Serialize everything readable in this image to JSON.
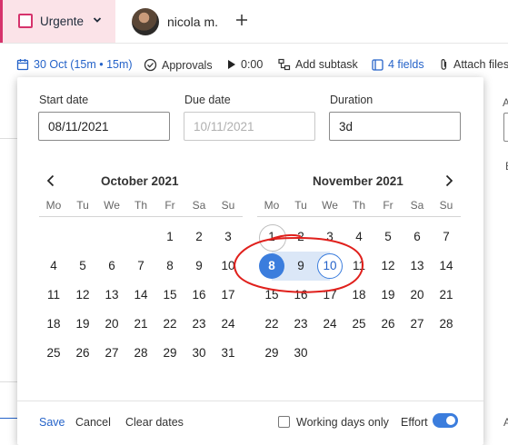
{
  "header": {
    "status_label": "Urgente",
    "user_name": "nicola m."
  },
  "toolbar": {
    "date_label": "30 Oct (15m • 15m)",
    "approvals_label": "Approvals",
    "time_label": "0:00",
    "add_subtask_label": "Add subtask",
    "fields_label": "4 fields",
    "attach_label": "Attach files"
  },
  "background": {
    "right_a": "A",
    "right_e": "E",
    "right_a2": "A"
  },
  "date_picker": {
    "start_date_label": "Start date",
    "start_date_value": "08/11/2021",
    "due_date_label": "Due date",
    "due_date_placeholder": "10/11/2021",
    "duration_label": "Duration",
    "duration_value": "3d",
    "weekdays": [
      "Mo",
      "Tu",
      "We",
      "Th",
      "Fr",
      "Sa",
      "Su"
    ],
    "months": [
      {
        "title": "October 2021",
        "days": [
          {
            "d": "",
            "empty": true
          },
          {
            "d": "",
            "empty": true
          },
          {
            "d": "",
            "empty": true
          },
          {
            "d": "",
            "empty": true
          },
          {
            "d": "1"
          },
          {
            "d": "2"
          },
          {
            "d": "3"
          },
          {
            "d": "4"
          },
          {
            "d": "5"
          },
          {
            "d": "6"
          },
          {
            "d": "7"
          },
          {
            "d": "8"
          },
          {
            "d": "9"
          },
          {
            "d": "10"
          },
          {
            "d": "11"
          },
          {
            "d": "12"
          },
          {
            "d": "13"
          },
          {
            "d": "14"
          },
          {
            "d": "15"
          },
          {
            "d": "16"
          },
          {
            "d": "17"
          },
          {
            "d": "18"
          },
          {
            "d": "19"
          },
          {
            "d": "20"
          },
          {
            "d": "21"
          },
          {
            "d": "22"
          },
          {
            "d": "23"
          },
          {
            "d": "24"
          },
          {
            "d": "25"
          },
          {
            "d": "26"
          },
          {
            "d": "27"
          },
          {
            "d": "28"
          },
          {
            "d": "29"
          },
          {
            "d": "30"
          },
          {
            "d": "31"
          }
        ]
      },
      {
        "title": "November 2021",
        "days": [
          {
            "d": "1",
            "state": "today"
          },
          {
            "d": "2"
          },
          {
            "d": "3"
          },
          {
            "d": "4"
          },
          {
            "d": "5"
          },
          {
            "d": "6"
          },
          {
            "d": "7"
          },
          {
            "d": "8",
            "state": "start"
          },
          {
            "d": "9",
            "state": "range"
          },
          {
            "d": "10",
            "state": "end"
          },
          {
            "d": "11"
          },
          {
            "d": "12"
          },
          {
            "d": "13"
          },
          {
            "d": "14"
          },
          {
            "d": "15"
          },
          {
            "d": "16"
          },
          {
            "d": "17"
          },
          {
            "d": "18"
          },
          {
            "d": "19"
          },
          {
            "d": "20"
          },
          {
            "d": "21"
          },
          {
            "d": "22"
          },
          {
            "d": "23"
          },
          {
            "d": "24"
          },
          {
            "d": "25"
          },
          {
            "d": "26"
          },
          {
            "d": "27"
          },
          {
            "d": "28"
          },
          {
            "d": "29"
          },
          {
            "d": "30"
          }
        ]
      }
    ],
    "footer": {
      "save_label": "Save",
      "cancel_label": "Cancel",
      "clear_label": "Clear dates",
      "working_days_label": "Working days only",
      "working_days_checked": false,
      "effort_label": "Effort",
      "effort_on": true
    }
  },
  "colors": {
    "accent": "#3b7ddd",
    "range": "#dbe7f7",
    "urgent_bg": "#fbe3e8",
    "urgent_border": "#d6336c",
    "annotation": "#e0201c"
  }
}
